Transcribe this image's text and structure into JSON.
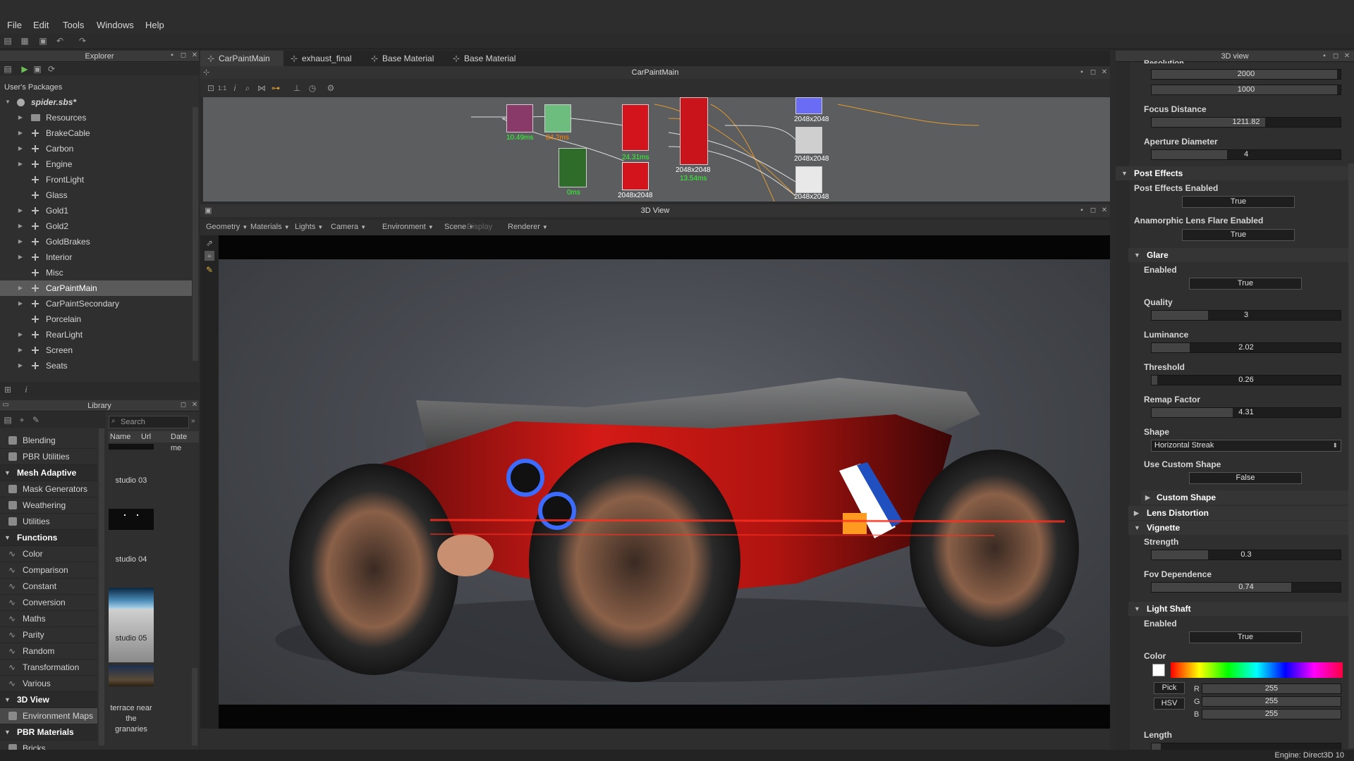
{
  "menu": {
    "file": "File",
    "edit": "Edit",
    "tools": "Tools",
    "windows": "Windows",
    "help": "Help"
  },
  "explorer": {
    "title": "Explorer",
    "root_label": "User's Packages",
    "package": "spider.sbs*",
    "items": [
      {
        "label": "Resources",
        "type": "folder",
        "arrow": true
      },
      {
        "label": "BrakeCable",
        "type": "graph",
        "arrow": true
      },
      {
        "label": "Carbon",
        "type": "graph",
        "arrow": true
      },
      {
        "label": "Engine",
        "type": "graph",
        "arrow": true
      },
      {
        "label": "FrontLight",
        "type": "graph",
        "arrow": false
      },
      {
        "label": "Glass",
        "type": "graph",
        "arrow": false
      },
      {
        "label": "Gold1",
        "type": "graph",
        "arrow": true
      },
      {
        "label": "Gold2",
        "type": "graph",
        "arrow": true
      },
      {
        "label": "GoldBrakes",
        "type": "graph",
        "arrow": true
      },
      {
        "label": "Interior",
        "type": "graph",
        "arrow": true
      },
      {
        "label": "Misc",
        "type": "graph",
        "arrow": false
      },
      {
        "label": "CarPaintMain",
        "type": "graph",
        "arrow": true,
        "selected": true
      },
      {
        "label": "CarPaintSecondary",
        "type": "graph",
        "arrow": true
      },
      {
        "label": "Porcelain",
        "type": "graph",
        "arrow": false
      },
      {
        "label": "RearLight",
        "type": "graph",
        "arrow": true
      },
      {
        "label": "Screen",
        "type": "graph",
        "arrow": true
      },
      {
        "label": "Seats",
        "type": "graph",
        "arrow": true
      }
    ]
  },
  "library": {
    "title": "Library",
    "search_placeholder": "Search",
    "columns": {
      "name": "Name",
      "url": "Url",
      "date": "Date me"
    },
    "categories": [
      {
        "label": "Blending",
        "kind": "item"
      },
      {
        "label": "PBR Utilities",
        "kind": "item"
      },
      {
        "label": "Mesh Adaptive",
        "kind": "cat"
      },
      {
        "label": "Mask Generators",
        "kind": "item"
      },
      {
        "label": "Weathering",
        "kind": "item"
      },
      {
        "label": "Utilities",
        "kind": "item"
      },
      {
        "label": "Functions",
        "kind": "cat"
      },
      {
        "label": "Color",
        "kind": "fn"
      },
      {
        "label": "Comparison",
        "kind": "fn"
      },
      {
        "label": "Constant",
        "kind": "fn"
      },
      {
        "label": "Conversion",
        "kind": "fn"
      },
      {
        "label": "Maths",
        "kind": "fn"
      },
      {
        "label": "Parity",
        "kind": "fn"
      },
      {
        "label": "Random",
        "kind": "fn"
      },
      {
        "label": "Transformation",
        "kind": "fn"
      },
      {
        "label": "Various",
        "kind": "fn"
      },
      {
        "label": "3D View",
        "kind": "cat"
      },
      {
        "label": "Environment Maps",
        "kind": "item",
        "selected": true
      },
      {
        "label": "PBR Materials",
        "kind": "cat"
      },
      {
        "label": "Bricks",
        "kind": "item"
      }
    ],
    "thumbs": [
      {
        "label": "studio 03"
      },
      {
        "label": "studio 04"
      },
      {
        "label": "studio 05"
      },
      {
        "label": "terrace near the granaries"
      }
    ]
  },
  "tabs": [
    {
      "label": "CarPaintMain",
      "active": true
    },
    {
      "label": "exhaust_final"
    },
    {
      "label": "Base Material"
    },
    {
      "label": "Base Material"
    }
  ],
  "graph": {
    "title": "CarPaintMain",
    "node_labels": [
      "10.49ms",
      "84.2ms",
      "0ms",
      "24.31ms",
      "2048x2048",
      "2048x2048",
      "13.54ms",
      "2048x2048",
      "2048x2048",
      "2048x2048"
    ]
  },
  "view3d": {
    "title": "3D View",
    "menus": [
      "Geometry",
      "Materials",
      "Lights",
      "Camera",
      "Environment",
      "Scene",
      "Display",
      "Renderer"
    ]
  },
  "props": {
    "title": "3D view",
    "resolution_top": "Resolution",
    "res_w": "2000",
    "res_h": "1000",
    "focus_distance": {
      "label": "Focus Distance",
      "value": "1211.82"
    },
    "aperture": {
      "label": "Aperture Diameter",
      "value": "4"
    },
    "post_effects": "Post Effects",
    "post_enabled": {
      "label": "Post Effects Enabled",
      "value": "True"
    },
    "anamorphic": {
      "label": "Anamorphic Lens Flare Enabled",
      "value": "True"
    },
    "glare": "Glare",
    "glare_enabled": {
      "label": "Enabled",
      "value": "True"
    },
    "quality": {
      "label": "Quality",
      "value": "3"
    },
    "luminance": {
      "label": "Luminance",
      "value": "2.02"
    },
    "threshold": {
      "label": "Threshold",
      "value": "0.26"
    },
    "remap": {
      "label": "Remap Factor",
      "value": "4.31"
    },
    "shape": {
      "label": "Shape",
      "value": "Horizontal Streak"
    },
    "custom_shape_use": {
      "label": "Use Custom Shape",
      "value": "False"
    },
    "custom_shape": "Custom Shape",
    "lens_distortion": "Lens Distortion",
    "vignette": "Vignette",
    "strength": {
      "label": "Strength",
      "value": "0.3"
    },
    "fov": {
      "label": "Fov Dependence",
      "value": "0.74"
    },
    "light_shaft": "Light Shaft",
    "ls_enabled": {
      "label": "Enabled",
      "value": "True"
    },
    "color": {
      "label": "Color",
      "pick": "Pick",
      "hsv": "HSV",
      "r": "255",
      "g": "255",
      "b": "255",
      "r_label": "R",
      "g_label": "G",
      "b_label": "B"
    },
    "length": {
      "label": "Length"
    }
  },
  "status": {
    "engine": "Engine: Direct3D 10"
  }
}
